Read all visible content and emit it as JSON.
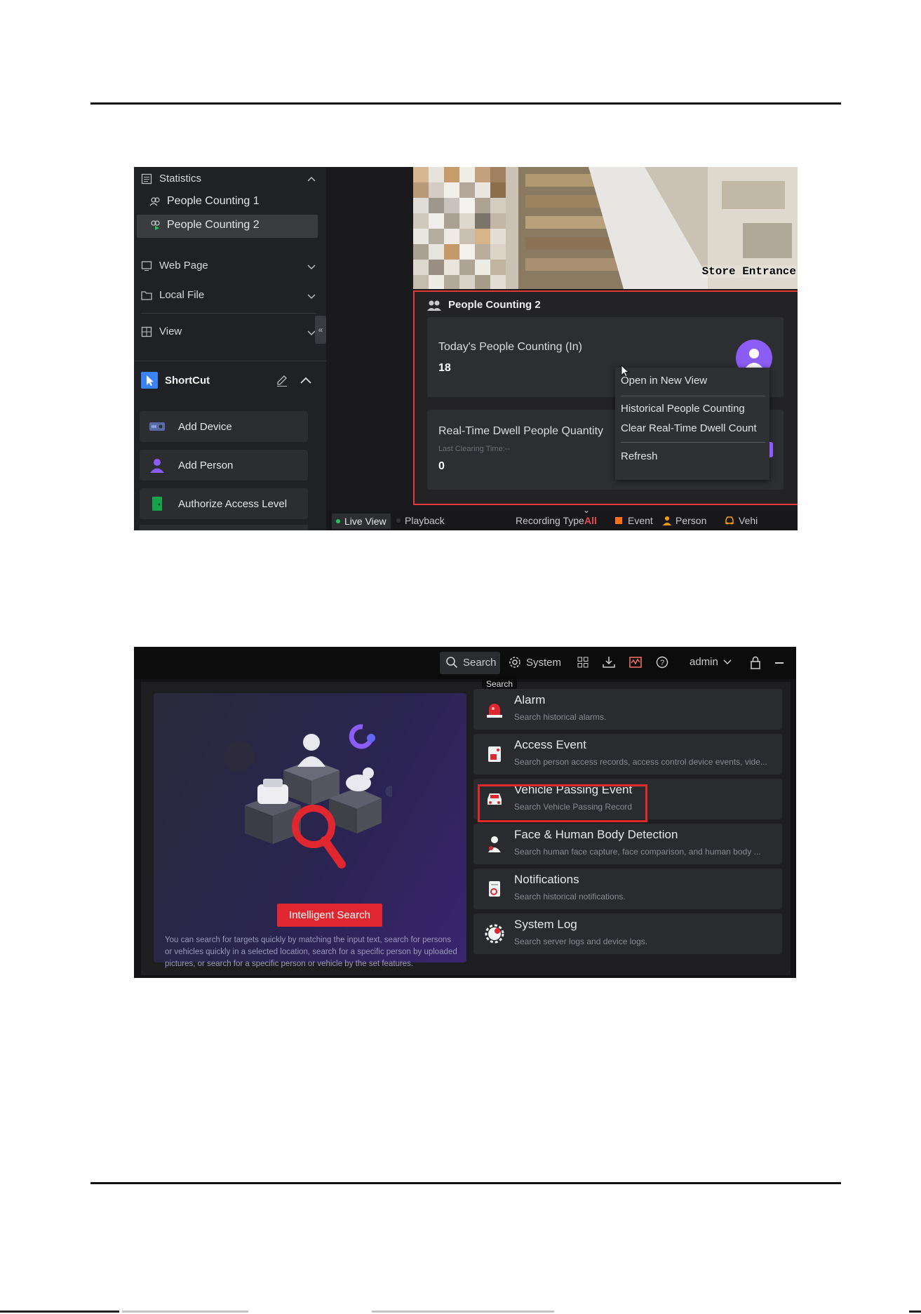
{
  "shot1": {
    "sidebar": {
      "statistics_label": "Statistics",
      "items": [
        "People Counting 1",
        "People Counting 2"
      ],
      "web_page_label": "Web Page",
      "local_file_label": "Local File",
      "view_label": "View",
      "collapse_glyph": "«",
      "shortcut_label": "ShortCut",
      "shortcuts": [
        "Add Device",
        "Add Person",
        "Authorize Access Level"
      ]
    },
    "video": {
      "overlay_text": "Store Entrance"
    },
    "panel": {
      "title": "People Counting 2",
      "card1_title": "Today's People Counting (In)",
      "card1_value": "18",
      "card2_title": "Real-Time Dwell People Quantity",
      "card2_sub": "Last Clearing Time:--",
      "card2_value": "0"
    },
    "context_menu": {
      "items": [
        "Open in New View",
        "Historical People Counting",
        "Clear Real-Time Dwell Count",
        "Refresh"
      ]
    },
    "bottom_bar": {
      "live_view": "Live View",
      "playback": "Playback",
      "recording_type_label": "Recording Type",
      "recording_type_value": "All",
      "event": "Event",
      "person": "Person",
      "vehicle": "Vehi"
    }
  },
  "shot2": {
    "topbar": {
      "search": "Search",
      "system": "System",
      "user": "admin",
      "tooltip": "Search"
    },
    "hero": {
      "button_label": "Intelligent Search",
      "description": "You can search for targets quickly by matching the input text, search for persons or vehicles quickly in a selected location, search for a specific person by uploaded pictures, or search for a specific person or vehicle by the set features."
    },
    "categories": [
      {
        "title": "Alarm",
        "desc": "Search historical alarms."
      },
      {
        "title": "Access Event",
        "desc": "Search person access records, access control device events, vide..."
      },
      {
        "title": "Vehicle Passing Event",
        "desc": "Search Vehicle Passing Record"
      },
      {
        "title": "Face & Human Body Detection",
        "desc": "Search human face capture, face comparison, and human body ..."
      },
      {
        "title": "Notifications",
        "desc": "Search historical notifications."
      },
      {
        "title": "System Log",
        "desc": "Search server logs and device logs."
      }
    ]
  },
  "colors": {
    "highlight": "#e53935",
    "accent_purple": "#8b5cf6",
    "button_red": "#e0272f"
  }
}
